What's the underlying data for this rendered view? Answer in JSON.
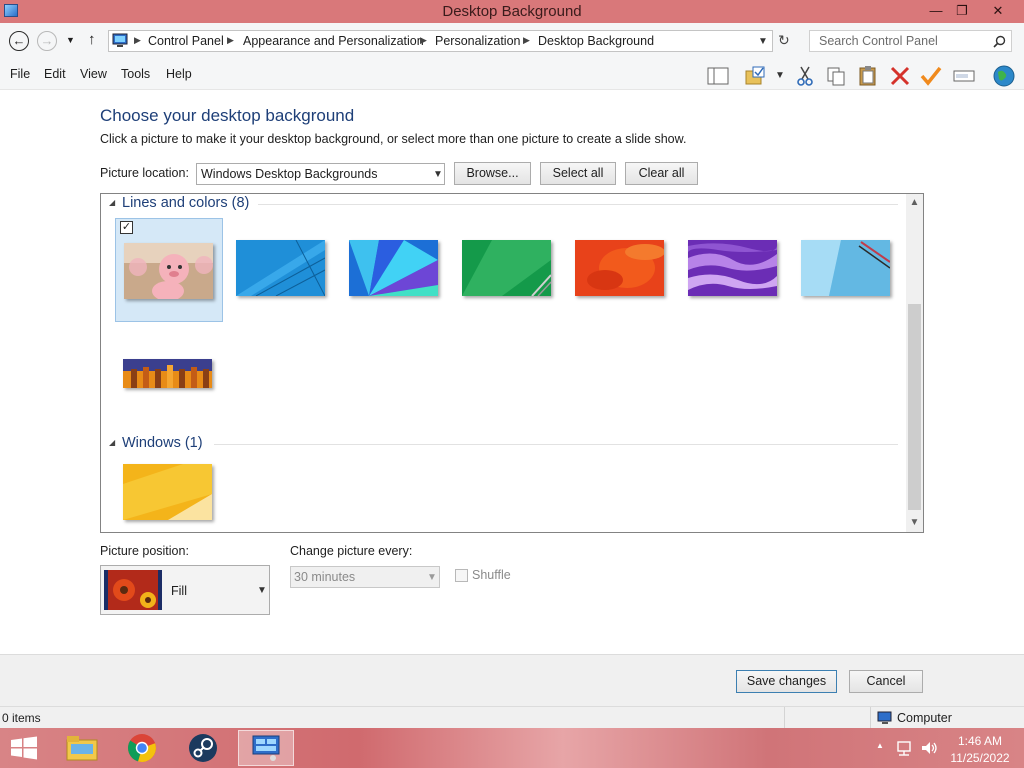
{
  "window": {
    "title": "Desktop Background",
    "controls": {
      "minimize": "—",
      "restore": "❐",
      "close": "✕"
    }
  },
  "address": {
    "breadcrumbs": [
      "Control Panel",
      "Appearance and Personalization",
      "Personalization",
      "Desktop Background"
    ],
    "search_placeholder": "Search Control Panel"
  },
  "menu": [
    "File",
    "Edit",
    "View",
    "Tools",
    "Help"
  ],
  "toolbar": {
    "icons": [
      "layout-pane-icon",
      "folder-options-icon",
      "cut-icon",
      "copy-icon",
      "paste-icon",
      "delete-icon",
      "properties-check-icon",
      "rename-icon",
      "globe-icon"
    ]
  },
  "content": {
    "title": "Choose your desktop background",
    "subtitle": "Click a picture to make it your desktop background, or select more than one picture to create a slide show.",
    "location_label": "Picture location:",
    "location_value": "Windows Desktop Backgrounds",
    "browse_label": "Browse...",
    "select_all_label": "Select all",
    "clear_all_label": "Clear all"
  },
  "groups": [
    {
      "name": "Lines and colors (8)",
      "thumbnails": [
        {
          "name": "cartoon-pig-wallpaper",
          "checked": true,
          "selected": true
        },
        {
          "name": "blue-lines-wallpaper",
          "checked": false,
          "selected": false
        },
        {
          "name": "blue-fan-wallpaper",
          "checked": false,
          "selected": false
        },
        {
          "name": "green-wallpaper",
          "checked": false,
          "selected": false
        },
        {
          "name": "red-orange-wallpaper",
          "checked": false,
          "selected": false
        },
        {
          "name": "purple-waves-wallpaper",
          "checked": false,
          "selected": false
        },
        {
          "name": "light-blue-wallpaper",
          "checked": false,
          "selected": false
        },
        {
          "name": "orange-bars-wallpaper",
          "checked": false,
          "selected": false
        }
      ]
    },
    {
      "name": "Windows (1)",
      "thumbnails": [
        {
          "name": "yellow-windows-wallpaper",
          "checked": false,
          "selected": false
        }
      ]
    }
  ],
  "options": {
    "position_label": "Picture position:",
    "position_value": "Fill",
    "interval_label": "Change picture every:",
    "interval_value": "30 minutes",
    "interval_enabled": false,
    "shuffle_label": "Shuffle",
    "shuffle_enabled": false
  },
  "footer": {
    "save_label": "Save changes",
    "cancel_label": "Cancel"
  },
  "status": {
    "items": "0 items",
    "location": "Computer"
  },
  "taskbar": {
    "apps": [
      "file-explorer-icon",
      "chrome-icon",
      "steam-icon",
      "control-panel-icon"
    ],
    "time": "1:46 AM",
    "date": "11/25/2022"
  },
  "colors": {
    "titlebar": "#d9787a",
    "heading": "#1e3f78",
    "selection": "#d5e8f7",
    "taskbar": "#d06a6e"
  }
}
